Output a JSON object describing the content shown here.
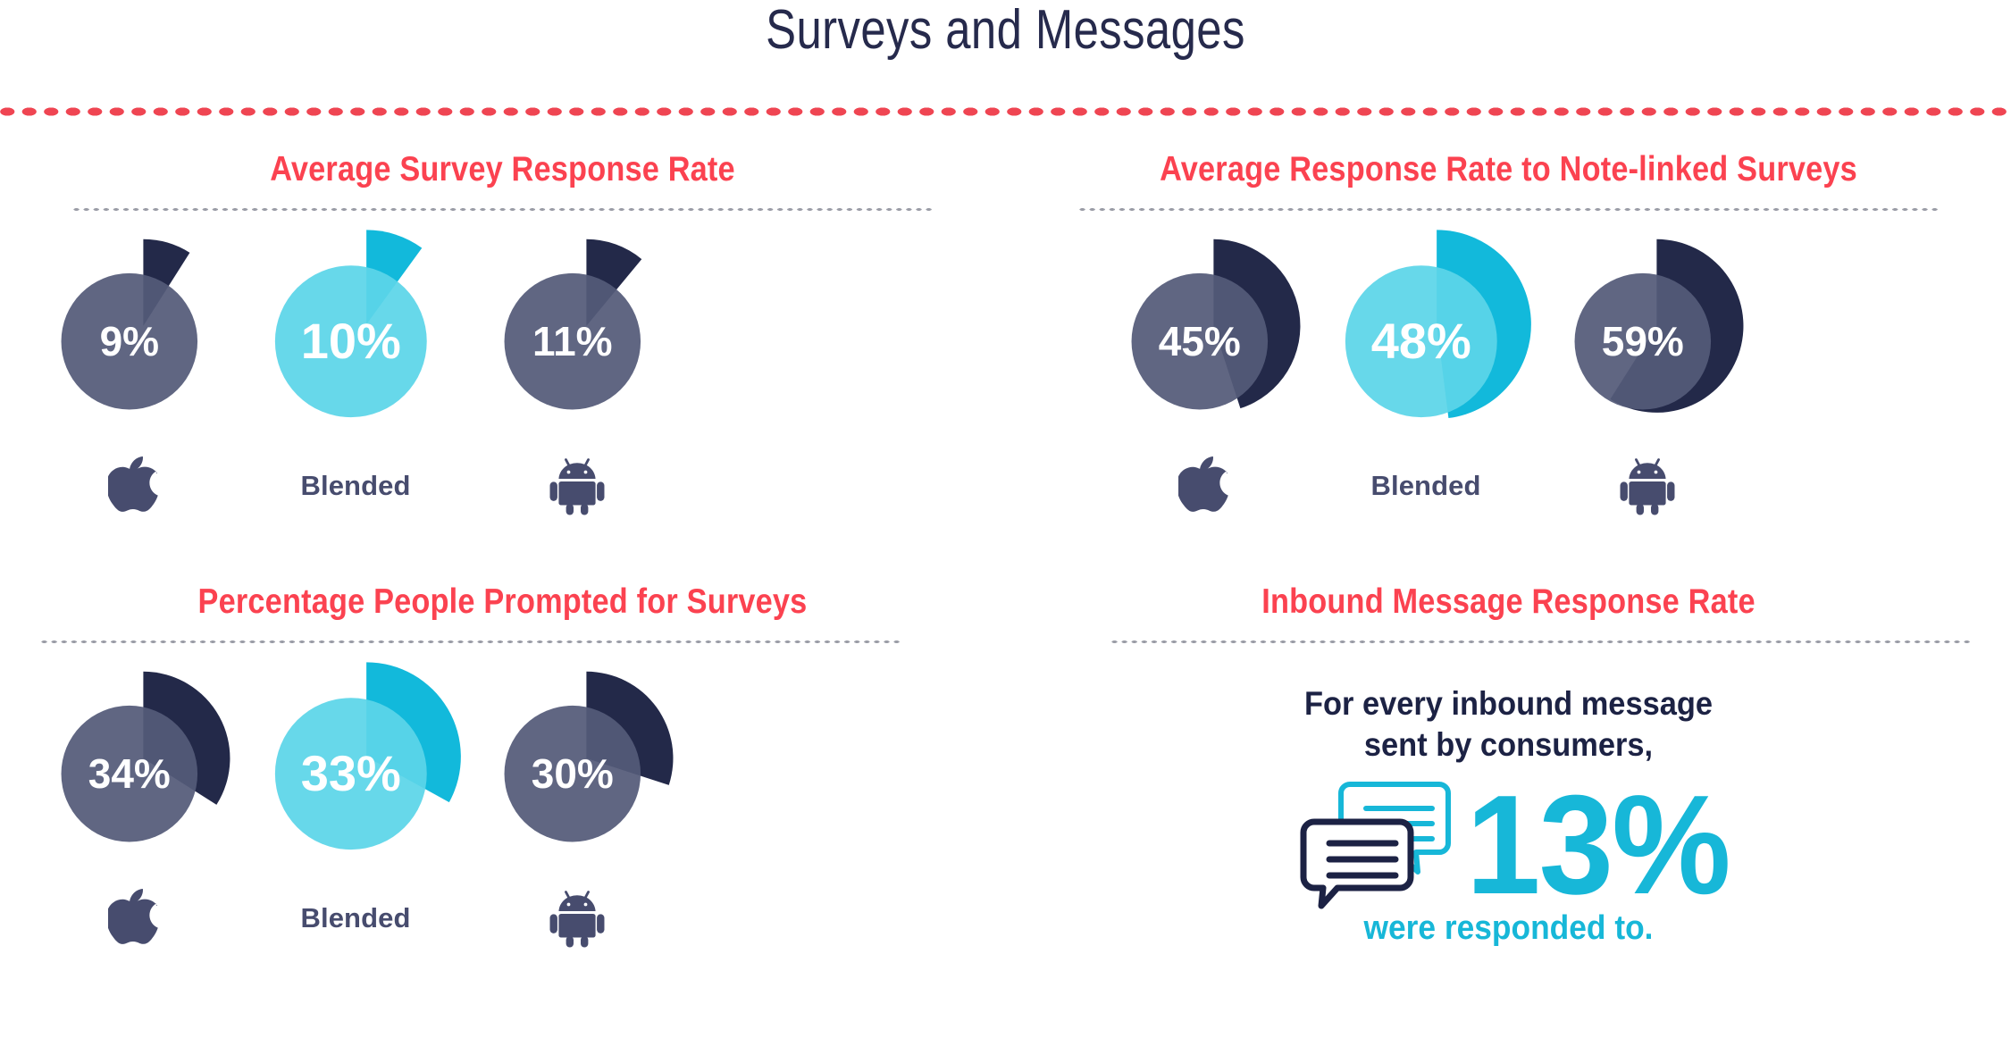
{
  "header": {
    "title": "Surveys and Messages"
  },
  "colors": {
    "title_navy": "#262A4C",
    "heading_red": "#FB4250",
    "dot_rule_red": "#EF4552",
    "dot_rule_grey": "#9A9CA6",
    "slate_base": "#545A78",
    "dark_navy_wedge": "#232949",
    "cyan_base": "#5BD5E8",
    "cyan_wedge": "#12B9DB",
    "cyan_text": "#17B7D8",
    "label_slate": "#474C6E",
    "lead_navy": "#1C2244"
  },
  "panels": [
    {
      "id": "average-survey-response-rate",
      "title": "Average Survey Response Rate",
      "items": [
        {
          "value": "9%",
          "pct": 9,
          "label": "",
          "icon": "apple-icon",
          "style": "slate"
        },
        {
          "value": "10%",
          "pct": 10,
          "label": "Blended",
          "icon": "text",
          "style": "cyan"
        },
        {
          "value": "11%",
          "pct": 11,
          "label": "",
          "icon": "android-icon",
          "style": "slate"
        }
      ]
    },
    {
      "id": "average-response-rate-note-linked-surveys",
      "title": "Average Response Rate to Note-linked Surveys",
      "items": [
        {
          "value": "45%",
          "pct": 45,
          "label": "",
          "icon": "apple-icon",
          "style": "slate"
        },
        {
          "value": "48%",
          "pct": 48,
          "label": "Blended",
          "icon": "text",
          "style": "cyan"
        },
        {
          "value": "59%",
          "pct": 59,
          "label": "",
          "icon": "android-icon",
          "style": "slate"
        }
      ]
    },
    {
      "id": "percentage-people-prompted-for-surveys",
      "title": "Percentage People Prompted for Surveys",
      "items": [
        {
          "value": "34%",
          "pct": 34,
          "label": "",
          "icon": "apple-icon",
          "style": "slate"
        },
        {
          "value": "33%",
          "pct": 33,
          "label": "Blended",
          "icon": "text",
          "style": "cyan"
        },
        {
          "value": "30%",
          "pct": 30,
          "label": "",
          "icon": "android-icon",
          "style": "slate"
        }
      ]
    },
    {
      "id": "inbound-message-response-rate",
      "title": "Inbound Message Response Rate",
      "inbound": {
        "lead": "For every inbound message\nsent by consumers,",
        "percent": "13%",
        "footer": "were responded to.",
        "icon": "chat-bubbles-icon"
      }
    }
  ],
  "chart_data": [
    {
      "type": "pie",
      "title": "Average Survey Response Rate",
      "categories": [
        "iOS",
        "Blended",
        "Android"
      ],
      "values": [
        9,
        10,
        11
      ],
      "unit": "%",
      "labels": [
        "9%",
        "10%",
        "11%"
      ],
      "legend": "none",
      "grid": false
    },
    {
      "type": "pie",
      "title": "Average Response Rate to Note-linked Surveys",
      "categories": [
        "iOS",
        "Blended",
        "Android"
      ],
      "values": [
        45,
        48,
        59
      ],
      "unit": "%",
      "labels": [
        "45%",
        "48%",
        "59%"
      ],
      "legend": "none",
      "grid": false
    },
    {
      "type": "pie",
      "title": "Percentage People Prompted for Surveys",
      "categories": [
        "iOS",
        "Blended",
        "Android"
      ],
      "values": [
        34,
        33,
        30
      ],
      "unit": "%",
      "labels": [
        "34%",
        "33%",
        "30%"
      ],
      "legend": "none",
      "grid": false
    },
    {
      "type": "table",
      "title": "Inbound Message Response Rate",
      "categories": [
        "Inbound messages responded to"
      ],
      "values": [
        13
      ],
      "unit": "%",
      "labels": [
        "13%"
      ],
      "annotations": [
        "For every inbound message sent by consumers,",
        "were responded to."
      ],
      "legend": "none",
      "grid": false
    }
  ]
}
